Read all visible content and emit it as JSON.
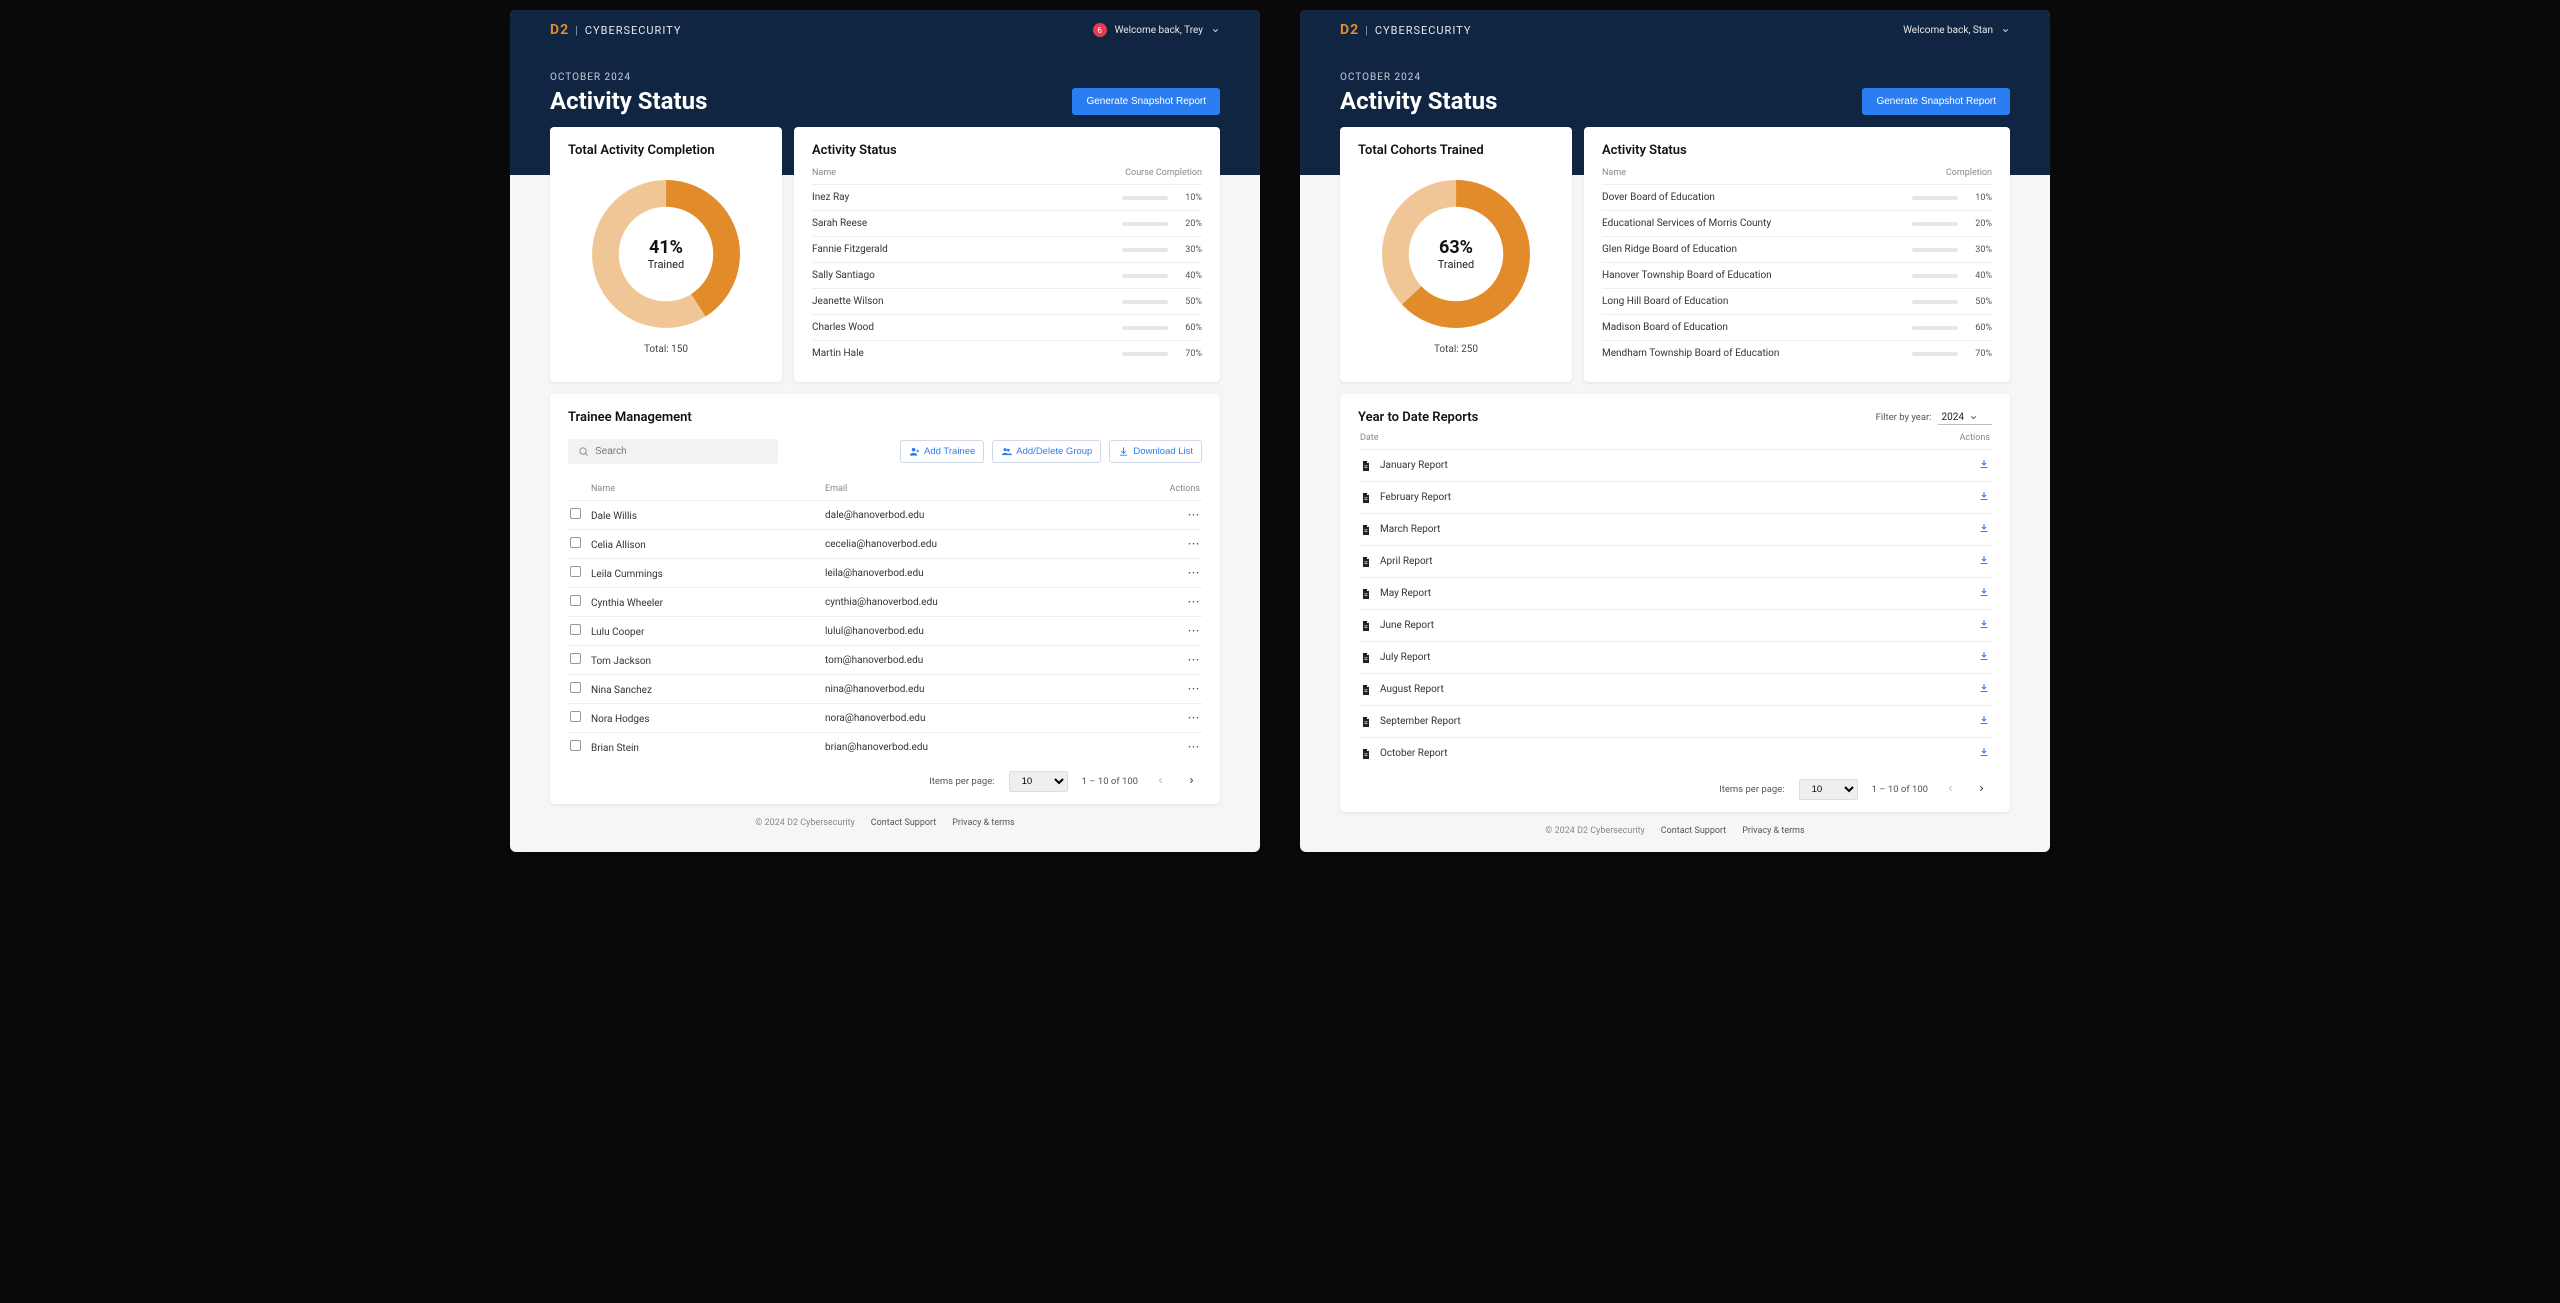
{
  "left": {
    "brand": {
      "d2": "D2",
      "name": "CYBERSECURITY"
    },
    "notif_count": "6",
    "welcome": "Welcome back, Trey",
    "date_label": "OCTOBER 2024",
    "page_title": "Activity Status",
    "generate_btn": "Generate Snapshot Report",
    "donut": {
      "title": "Total Activity Completion",
      "percent_label": "41%",
      "trained_label": "Trained",
      "total_label": "Total: 150"
    },
    "status": {
      "title": "Activity Status",
      "col_name": "Name",
      "col_pct": "Course Completion",
      "rows": [
        {
          "name": "Inez Ray",
          "pct": "10%"
        },
        {
          "name": "Sarah Reese",
          "pct": "20%"
        },
        {
          "name": "Fannie Fitzgerald",
          "pct": "30%"
        },
        {
          "name": "Sally Santiago",
          "pct": "40%"
        },
        {
          "name": "Jeanette Wilson",
          "pct": "50%"
        },
        {
          "name": "Charles Wood",
          "pct": "60%"
        },
        {
          "name": "Martin Hale",
          "pct": "70%"
        }
      ]
    },
    "trainee": {
      "title": "Trainee Management",
      "search_placeholder": "Search",
      "add_trainee": "Add Trainee",
      "add_group": "Add/Delete Group",
      "download_list": "Download List",
      "col_name": "Name",
      "col_email": "Email",
      "col_actions": "Actions",
      "rows": [
        {
          "name": "Dale Willis",
          "email": "dale@hanoverbod.edu"
        },
        {
          "name": "Celia Allison",
          "email": "cecelia@hanoverbod.edu"
        },
        {
          "name": "Leila Cummings",
          "email": "leila@hanoverbod.edu"
        },
        {
          "name": "Cynthia Wheeler",
          "email": "cynthia@hanoverbod.edu"
        },
        {
          "name": "Lulu Cooper",
          "email": "lulul@hanoverbod.edu"
        },
        {
          "name": "Tom Jackson",
          "email": "tom@hanoverbod.edu"
        },
        {
          "name": "Nina Sanchez",
          "email": "nina@hanoverbod.edu"
        },
        {
          "name": "Nora Hodges",
          "email": "nora@hanoverbod.edu"
        },
        {
          "name": "Brian Stein",
          "email": "brian@hanoverbod.edu"
        }
      ],
      "items_per_page_label": "Items per page:",
      "items_per_page_value": "10",
      "range_label": "1 – 10 of 100"
    },
    "footer": {
      "copyright": "© 2024 D2 Cybersecurity",
      "contact": "Contact Support",
      "privacy": "Privacy & terms"
    }
  },
  "right": {
    "brand": {
      "d2": "D2",
      "name": "CYBERSECURITY"
    },
    "welcome": "Welcome back, Stan",
    "date_label": "OCTOBER 2024",
    "page_title": "Activity Status",
    "generate_btn": "Generate Snapshot Report",
    "donut": {
      "title": "Total Cohorts Trained",
      "percent_label": "63%",
      "trained_label": "Trained",
      "total_label": "Total: 250"
    },
    "status": {
      "title": "Activity Status",
      "col_name": "Name",
      "col_pct": "Completion",
      "rows": [
        {
          "name": "Dover Board of Education",
          "pct": "10%"
        },
        {
          "name": "Educational Services of Morris County",
          "pct": "20%"
        },
        {
          "name": "Glen Ridge Board of Education",
          "pct": "30%"
        },
        {
          "name": "Hanover Township Board of Education",
          "pct": "40%"
        },
        {
          "name": "Long Hill Board of Education",
          "pct": "50%"
        },
        {
          "name": "Madison Board of Education",
          "pct": "60%"
        },
        {
          "name": "Mendham Township Board of Education",
          "pct": "70%"
        }
      ]
    },
    "reports": {
      "title": "Year to Date Reports",
      "filter_label": "Filter by year:",
      "filter_value": "2024",
      "col_date": "Date",
      "col_actions": "Actions",
      "rows": [
        {
          "name": "January Report"
        },
        {
          "name": "February Report"
        },
        {
          "name": "March Report"
        },
        {
          "name": "April Report"
        },
        {
          "name": "May Report"
        },
        {
          "name": "June Report"
        },
        {
          "name": "July Report"
        },
        {
          "name": "August Report"
        },
        {
          "name": "September Report"
        },
        {
          "name": "October Report"
        }
      ],
      "items_per_page_label": "Items per page:",
      "items_per_page_value": "10",
      "range_label": "1 – 10 of 100"
    },
    "footer": {
      "copyright": "© 2024 D2 Cybersecurity",
      "contact": "Contact Support",
      "privacy": "Privacy & terms"
    }
  },
  "chart_data": [
    {
      "type": "pie",
      "title": "Total Activity Completion",
      "categories": [
        "Trained",
        "Not Trained"
      ],
      "values": [
        41,
        59
      ],
      "total": 150
    },
    {
      "type": "pie",
      "title": "Total Cohorts Trained",
      "categories": [
        "Trained",
        "Not Trained"
      ],
      "values": [
        63,
        37
      ],
      "total": 250
    },
    {
      "type": "bar",
      "title": "Activity Status (Trey)",
      "categories": [
        "Inez Ray",
        "Sarah Reese",
        "Fannie Fitzgerald",
        "Sally Santiago",
        "Jeanette Wilson",
        "Charles Wood",
        "Martin Hale"
      ],
      "values": [
        10,
        20,
        30,
        40,
        50,
        60,
        70
      ],
      "xlabel": "Name",
      "ylabel": "Course Completion",
      "ylim": [
        0,
        100
      ]
    },
    {
      "type": "bar",
      "title": "Activity Status (Stan)",
      "categories": [
        "Dover Board of Education",
        "Educational Services of Morris County",
        "Glen Ridge Board of Education",
        "Hanover Township Board of Education",
        "Long Hill Board of Education",
        "Madison Board of Education",
        "Mendham Township Board of Education"
      ],
      "values": [
        10,
        20,
        30,
        40,
        50,
        60,
        70
      ],
      "xlabel": "Name",
      "ylabel": "Completion",
      "ylim": [
        0,
        100
      ]
    }
  ]
}
